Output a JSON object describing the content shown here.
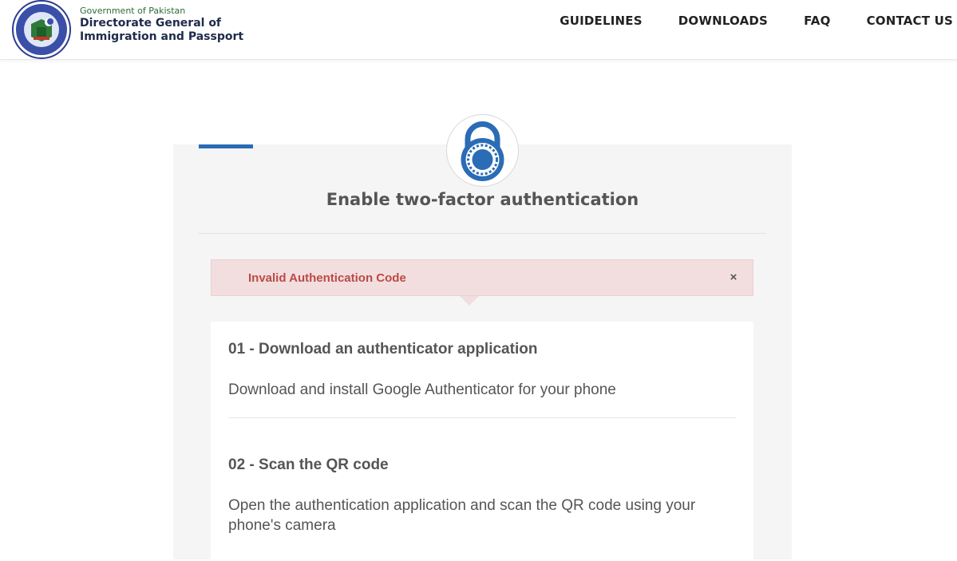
{
  "header": {
    "brand_sub": "Government of Pakistan",
    "brand_line1": "Directorate General of",
    "brand_line2": "Immigration and Passport",
    "logo_icon": "dgip-emblem-icon"
  },
  "nav": {
    "items": [
      "GUIDELINES",
      "DOWNLOADS",
      "FAQ",
      "CONTACT US"
    ]
  },
  "card": {
    "icon": "padlock-icon",
    "title": "Enable two-factor authentication"
  },
  "alert": {
    "message": "Invalid Authentication Code",
    "close_glyph": "×"
  },
  "steps": [
    {
      "title": "01 - Download an authenticator application",
      "description": "Download and install Google Authenticator for your phone"
    },
    {
      "title": "02 - Scan the QR code",
      "description": "Open the authentication application and scan the QR code using your phone's camera"
    }
  ],
  "colors": {
    "accent": "#2a6cb5",
    "alert_bg": "#f2dede",
    "alert_text": "#b94a48",
    "brand_green": "#2e6b3a",
    "brand_navy": "#1f2b4a"
  }
}
